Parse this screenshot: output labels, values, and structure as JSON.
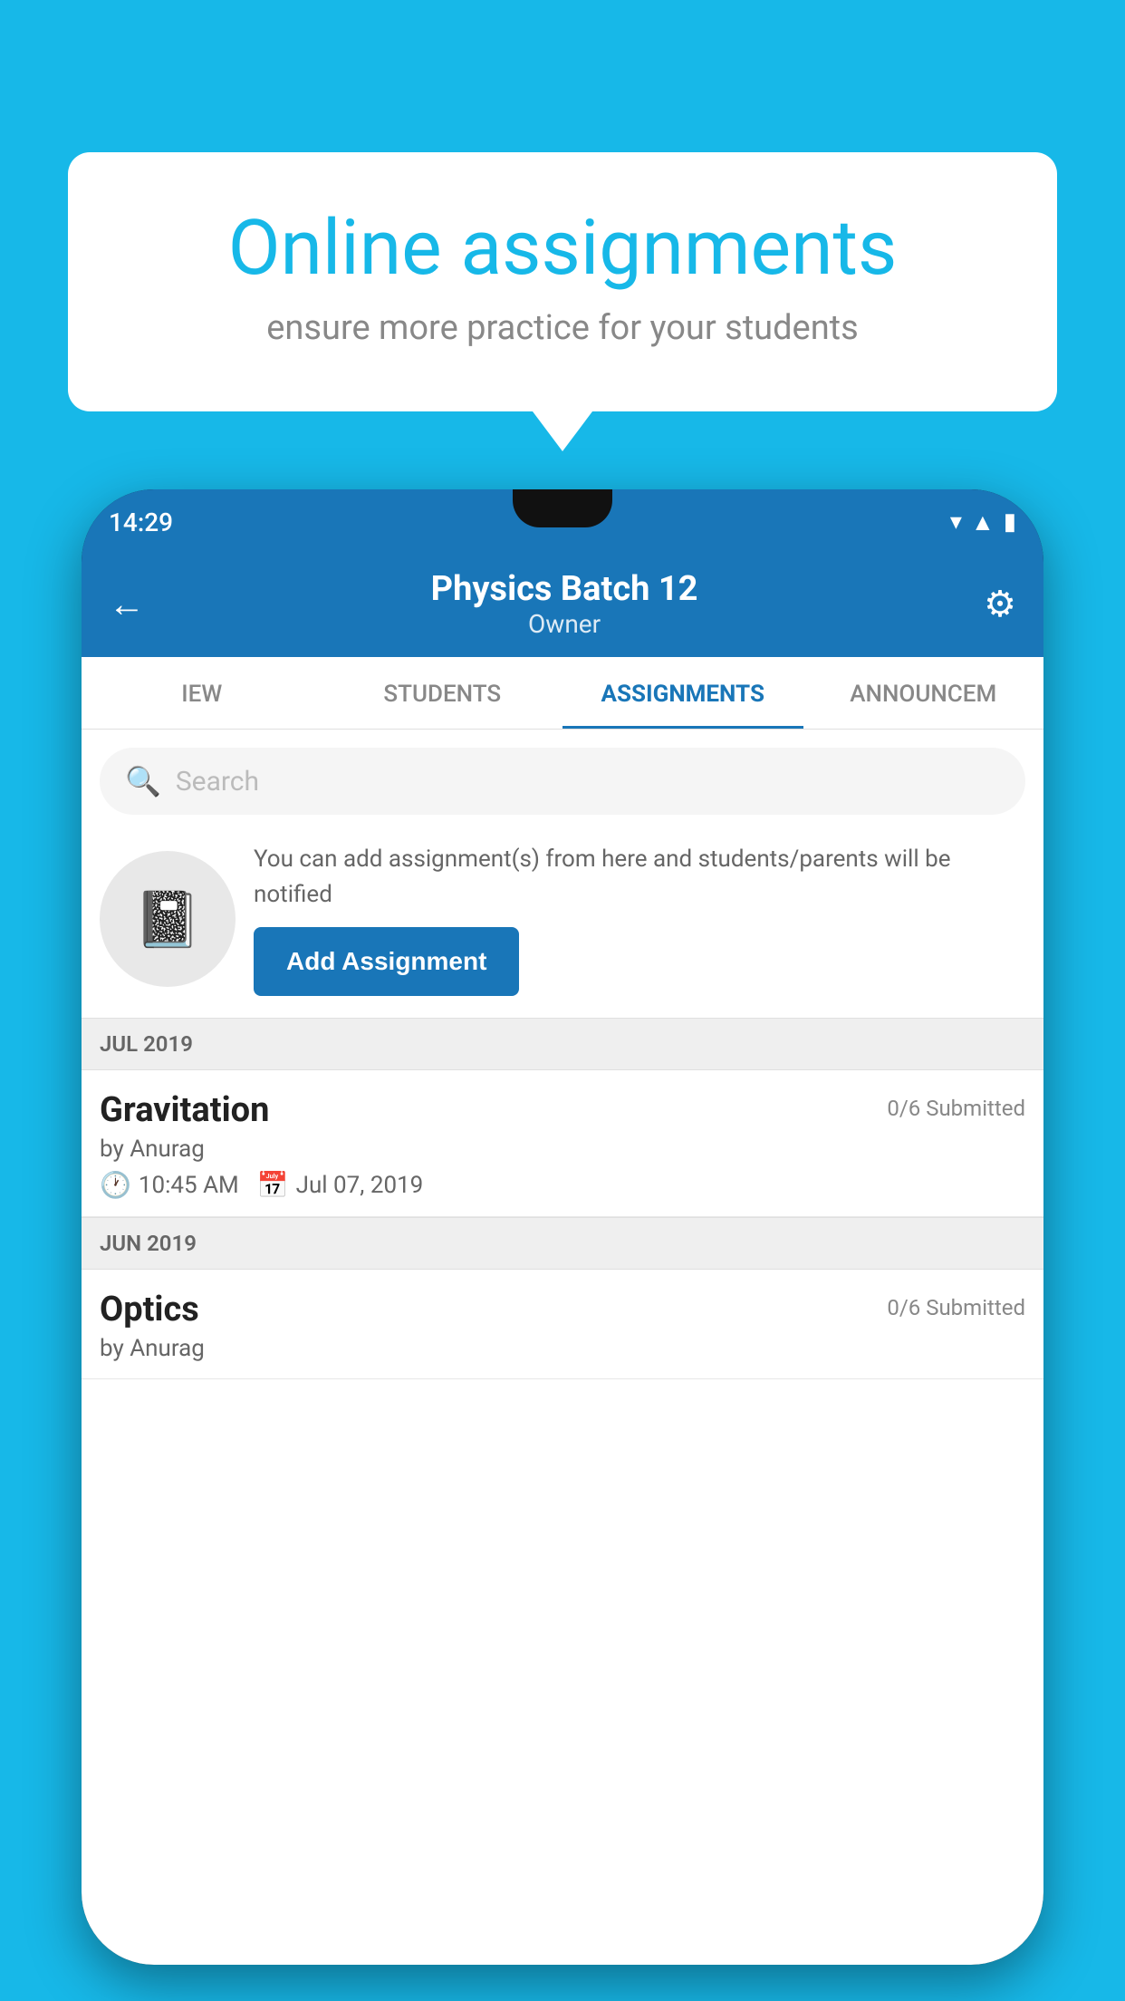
{
  "background_color": "#17b8e8",
  "bubble": {
    "title": "Online assignments",
    "subtitle": "ensure more practice for your students"
  },
  "phone": {
    "status_bar": {
      "time": "14:29",
      "icons": [
        "wifi",
        "signal",
        "battery"
      ]
    },
    "header": {
      "title": "Physics Batch 12",
      "subtitle": "Owner",
      "back_label": "←",
      "settings_label": "⚙"
    },
    "tabs": [
      {
        "label": "IEW",
        "active": false
      },
      {
        "label": "STUDENTS",
        "active": false
      },
      {
        "label": "ASSIGNMENTS",
        "active": true
      },
      {
        "label": "ANNOUNCEM",
        "active": false
      }
    ],
    "search": {
      "placeholder": "Search"
    },
    "promo": {
      "description": "You can add assignment(s) from here and students/parents will be notified",
      "button_label": "Add Assignment"
    },
    "assignments": [
      {
        "section": "JUL 2019",
        "name": "Gravitation",
        "submitted": "0/6 Submitted",
        "by": "by Anurag",
        "time": "10:45 AM",
        "date": "Jul 07, 2019"
      },
      {
        "section": "JUN 2019",
        "name": "Optics",
        "submitted": "0/6 Submitted",
        "by": "by Anurag",
        "time": "",
        "date": ""
      }
    ]
  }
}
